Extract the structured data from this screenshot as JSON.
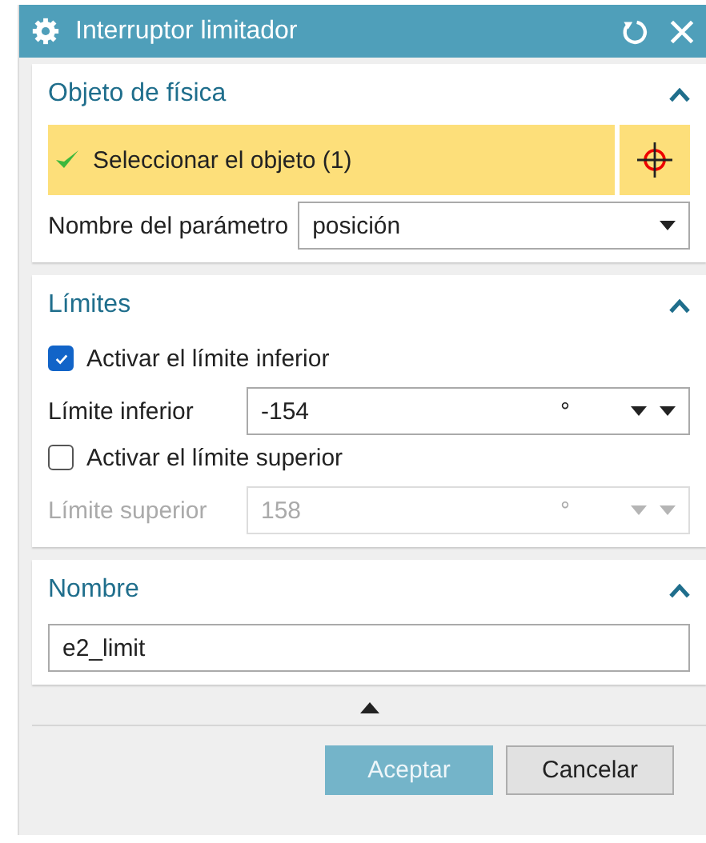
{
  "window": {
    "title": "Interruptor limitador"
  },
  "physics_object": {
    "title": "Objeto de física",
    "expanded": true,
    "selection": {
      "label": "Seleccionar el objeto (1)",
      "complete": true
    },
    "parameter": {
      "label": "Nombre del parámetro",
      "value": "posición"
    }
  },
  "limits": {
    "title": "Límites",
    "expanded": true,
    "rows": [
      {
        "checkbox_label": "Activar el límite inferior",
        "checked": true,
        "label": "Límite inferior",
        "value": "-154",
        "unit": "°",
        "disabled": false
      },
      {
        "checkbox_label": "Activar el límite superior",
        "checked": false,
        "label": "Límite superior",
        "value": "158",
        "unit": "°",
        "disabled": true
      }
    ]
  },
  "name": {
    "title": "Nombre",
    "expanded": true,
    "value": "e2_limit"
  },
  "more_options": {
    "expanded": false
  },
  "buttons": [
    {
      "label": "Aceptar",
      "kind": "primary"
    },
    {
      "label": "Cancelar",
      "kind": "secondary"
    }
  ]
}
